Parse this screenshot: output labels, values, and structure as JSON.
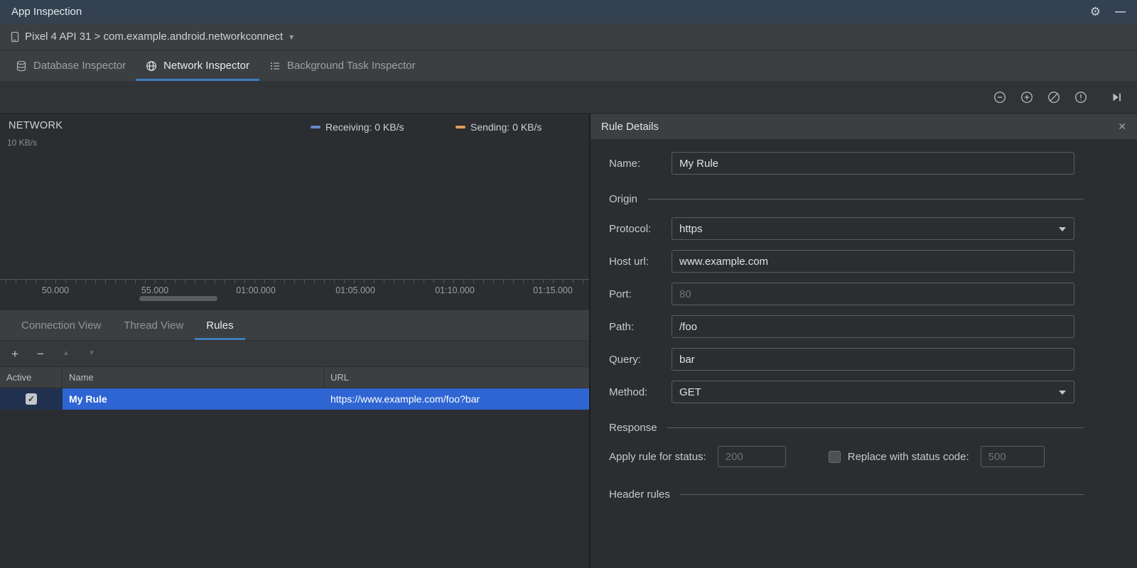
{
  "icons": {
    "gear": "⚙",
    "minimize": "—",
    "chevron_down": "▾",
    "close": "✕",
    "plus": "+",
    "minus": "−",
    "arrow_up": "▲",
    "arrow_down": "▼",
    "check": "✓"
  },
  "colors": {
    "accent_blue": "#3d7dbf",
    "selection_blue": "#2e65d3",
    "receiving": "#6688c7",
    "sending": "#dd9e5e"
  },
  "title_bar": {
    "title": "App Inspection"
  },
  "device_bar": {
    "selector": "Pixel 4 API 31 > com.example.android.networkconnect"
  },
  "inspector_tabs": [
    {
      "label": "Database Inspector"
    },
    {
      "label": "Network Inspector"
    },
    {
      "label": "Background Task Inspector"
    }
  ],
  "chart": {
    "title": "NETWORK",
    "y_axis_label": "10 KB/s",
    "legend": [
      {
        "label": "Receiving: 0 KB/s",
        "color": "#6688c7"
      },
      {
        "label": "Sending: 0 KB/s",
        "color": "#dd9e5e"
      }
    ],
    "ticks": [
      "50.000",
      "55.000",
      "01:00.000",
      "01:05.000",
      "01:10.000",
      "01:15.000"
    ]
  },
  "chart_data": {
    "type": "line",
    "x": [
      "50.000",
      "55.000",
      "01:00.000",
      "01:05.000",
      "01:10.000",
      "01:15.000"
    ],
    "series": [
      {
        "name": "Receiving",
        "unit": "KB/s",
        "values": [
          0,
          0,
          0,
          0,
          0,
          0
        ]
      },
      {
        "name": "Sending",
        "unit": "KB/s",
        "values": [
          0,
          0,
          0,
          0,
          0,
          0
        ]
      }
    ],
    "ylabel": "10 KB/s",
    "legend_position": "top"
  },
  "view_tabs": [
    {
      "label": "Connection View"
    },
    {
      "label": "Thread View"
    },
    {
      "label": "Rules"
    }
  ],
  "rules_table": {
    "columns": [
      "Active",
      "Name",
      "URL"
    ],
    "rows": [
      {
        "active": true,
        "name": "My Rule",
        "url": "https://www.example.com/foo?bar"
      }
    ]
  },
  "rule_details": {
    "title": "Rule Details",
    "name": {
      "label": "Name:",
      "value": "My Rule"
    },
    "origin": {
      "section": "Origin",
      "protocol": {
        "label": "Protocol:",
        "value": "https"
      },
      "host": {
        "label": "Host url:",
        "value": "www.example.com"
      },
      "port": {
        "label": "Port:",
        "placeholder": "80"
      },
      "path": {
        "label": "Path:",
        "value": "/foo"
      },
      "query": {
        "label": "Query:",
        "value": "bar"
      },
      "method": {
        "label": "Method:",
        "value": "GET"
      }
    },
    "response": {
      "section": "Response",
      "status_label": "Apply rule for status:",
      "status_placeholder": "200",
      "replace_label": "Replace with status code:",
      "replace_placeholder": "500"
    },
    "header_rules": {
      "section": "Header rules"
    }
  }
}
